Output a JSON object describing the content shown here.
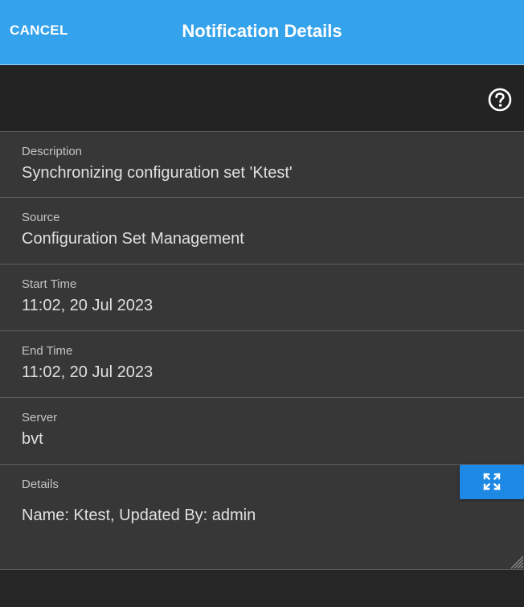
{
  "header": {
    "cancel_label": "CANCEL",
    "title": "Notification Details",
    "accent_color": "#35a2ec"
  },
  "toolbar": {
    "help_icon": "help-circle-icon"
  },
  "fields": {
    "description": {
      "label": "Description",
      "value": "Synchronizing configuration set 'Ktest'"
    },
    "source": {
      "label": "Source",
      "value": "Configuration Set Management"
    },
    "start_time": {
      "label": "Start Time",
      "value": "11:02, 20 Jul 2023"
    },
    "end_time": {
      "label": "End Time",
      "value": "11:02, 20 Jul 2023"
    },
    "server": {
      "label": "Server",
      "value": "bvt"
    },
    "details": {
      "label": "Details",
      "value": "Name: Ktest, Updated By: admin",
      "expand_icon": "expand-icon",
      "expand_button_color": "#1e88e5"
    }
  }
}
